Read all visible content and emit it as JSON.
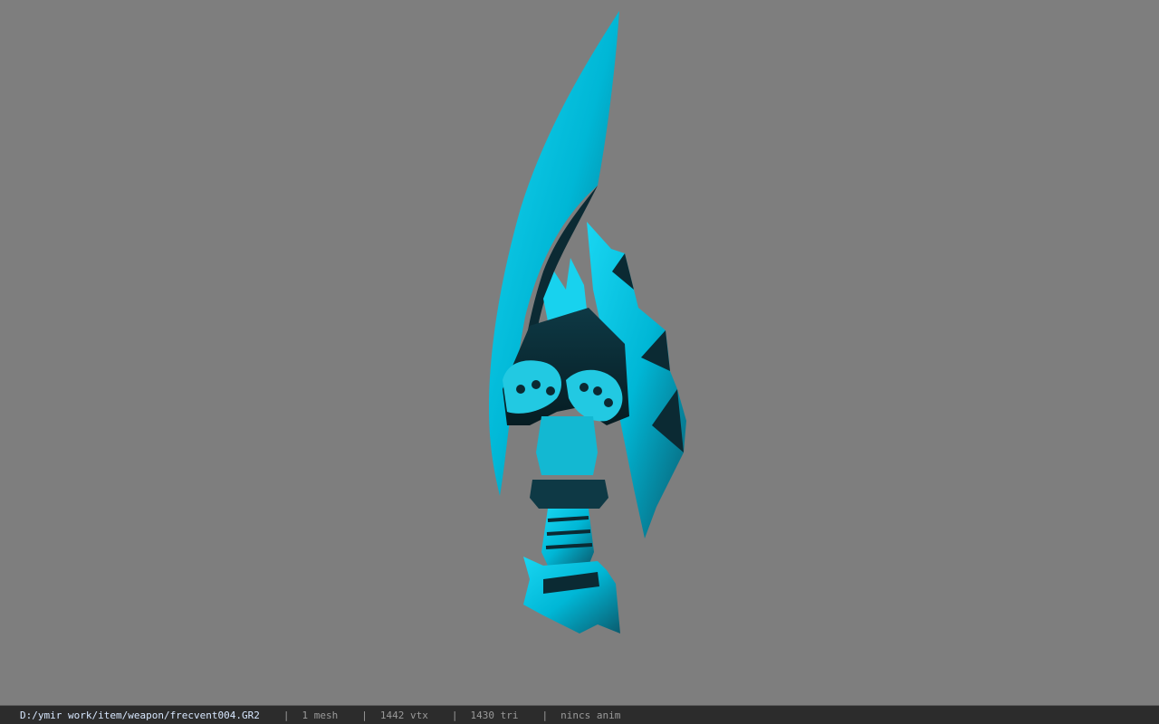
{
  "viewer": {
    "background_color": "#7e7e7e",
    "model": {
      "primary_color": "#00c8e6",
      "shadow_color": "#0b2a33"
    }
  },
  "status_bar": {
    "file_path": "D:/ymir work/item/weapon/frecvent004.GR2",
    "separator": "|",
    "mesh_count": "1 mesh",
    "vertex_count": "1442 vtx",
    "triangle_count": "1430 tri",
    "anim_status": "nincs anim"
  }
}
